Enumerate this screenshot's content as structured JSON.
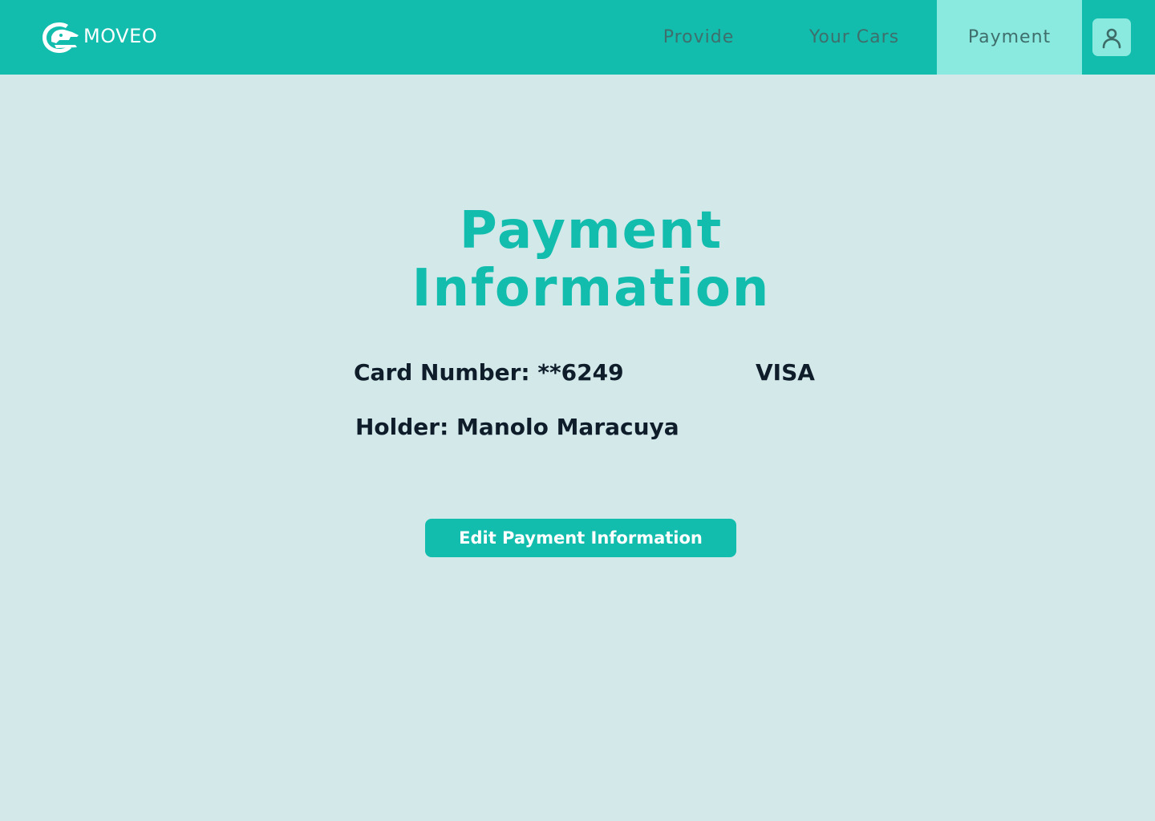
{
  "header": {
    "logo_text": "MOVEO",
    "nav": [
      {
        "label": "Provide"
      },
      {
        "label": "Your Cars"
      },
      {
        "label": "Payment",
        "active": true
      }
    ],
    "profile_icon": "user-icon"
  },
  "main": {
    "title_line1": "Payment",
    "title_line2": "Information",
    "card_number_label": "Card Number: **6249",
    "card_brand": "VISA",
    "holder_label": "Holder: Manolo Maracuya",
    "edit_button_label": "Edit Payment Information"
  },
  "colors": {
    "primary": "#12bdad",
    "nav_active": "#8aeadf",
    "background": "#d2e8e9",
    "text_dark": "#0f1d2b",
    "nav_text": "#3f6f6c"
  }
}
